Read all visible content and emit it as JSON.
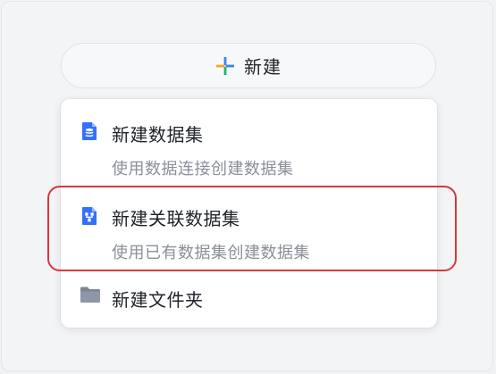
{
  "new_button": {
    "label": "新建"
  },
  "menu": {
    "items": [
      {
        "title": "新建数据集",
        "description": "使用数据连接创建数据集",
        "icon": "dataset-icon"
      },
      {
        "title": "新建关联数据集",
        "description": "使用已有数据集创建数据集",
        "icon": "joined-dataset-icon"
      },
      {
        "title": "新建文件夹",
        "icon": "folder-icon"
      }
    ]
  },
  "colors": {
    "accent_blue": "#3370ff",
    "highlight_red": "#d9363e",
    "folder_gray": "#7b8596",
    "plus_blue": "#3b82f6",
    "plus_orange": "#f5a623",
    "plus_green": "#22b46b",
    "plus_red": "#ee4b3b"
  }
}
